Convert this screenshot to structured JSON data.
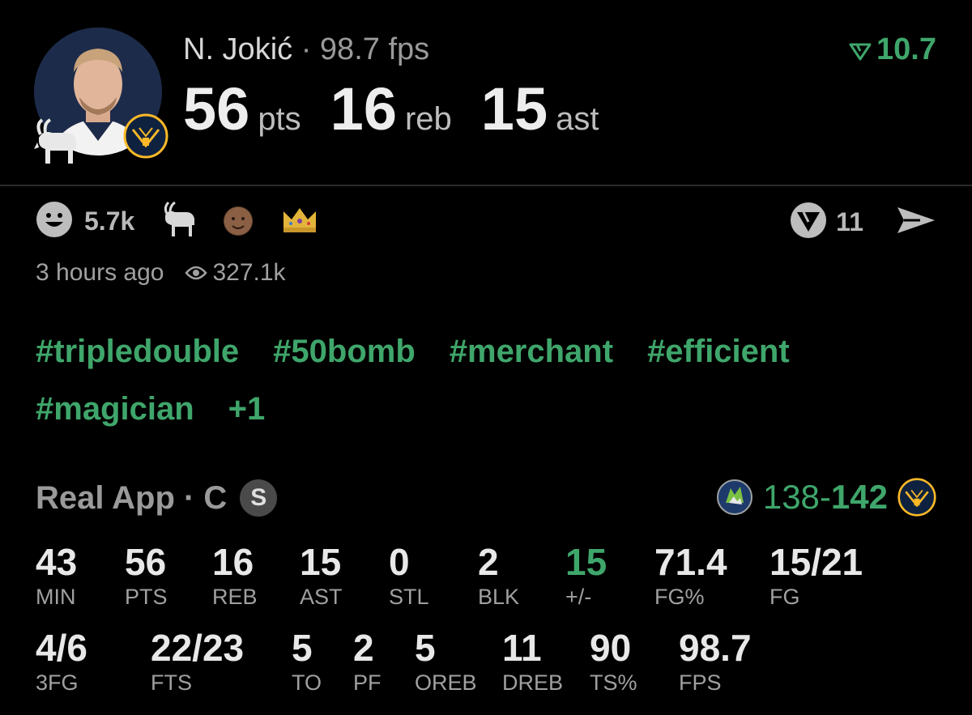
{
  "header": {
    "player_name": "N. Jokić",
    "separator": "·",
    "fps_text": "98.7 fps",
    "rating_score": "10.7",
    "stat_line": [
      {
        "value": "56",
        "unit": "pts"
      },
      {
        "value": "16",
        "unit": "reb"
      },
      {
        "value": "15",
        "unit": "ast"
      }
    ]
  },
  "reactions": {
    "reaction_count": "5.7k",
    "emoji_icons": [
      "goat-emoji-icon",
      "player-face-emoji-icon",
      "crown-emoji-icon"
    ],
    "vote_count": "11"
  },
  "meta": {
    "time_ago": "3 hours ago",
    "views": "327.1k"
  },
  "tags": [
    "#tripledouble",
    "#50bomb",
    "#merchant",
    "#efficient",
    "#magician",
    "+1"
  ],
  "game": {
    "title": "Real App · C",
    "badge": "S",
    "score_away": "138",
    "score_dash": "-",
    "score_home": "142"
  },
  "stats_row1": [
    {
      "value": "43",
      "label": "MIN"
    },
    {
      "value": "56",
      "label": "PTS"
    },
    {
      "value": "16",
      "label": "REB"
    },
    {
      "value": "15",
      "label": "AST"
    },
    {
      "value": "0",
      "label": "STL"
    },
    {
      "value": "2",
      "label": "BLK"
    },
    {
      "value": "15",
      "label": "+/-"
    },
    {
      "value": "71.4",
      "label": "FG%"
    },
    {
      "value": "15/21",
      "label": "FG"
    }
  ],
  "stats_row2": [
    {
      "value": "4/6",
      "label": "3FG"
    },
    {
      "value": "22/23",
      "label": "FTS"
    },
    {
      "value": "5",
      "label": "TO"
    },
    {
      "value": "2",
      "label": "PF"
    },
    {
      "value": "5",
      "label": "OREB"
    },
    {
      "value": "11",
      "label": "DREB"
    },
    {
      "value": "90",
      "label": "TS%"
    },
    {
      "value": "98.7",
      "label": "FPS"
    }
  ],
  "colors": {
    "accent_green": "#3fa66b",
    "background": "#000000"
  }
}
